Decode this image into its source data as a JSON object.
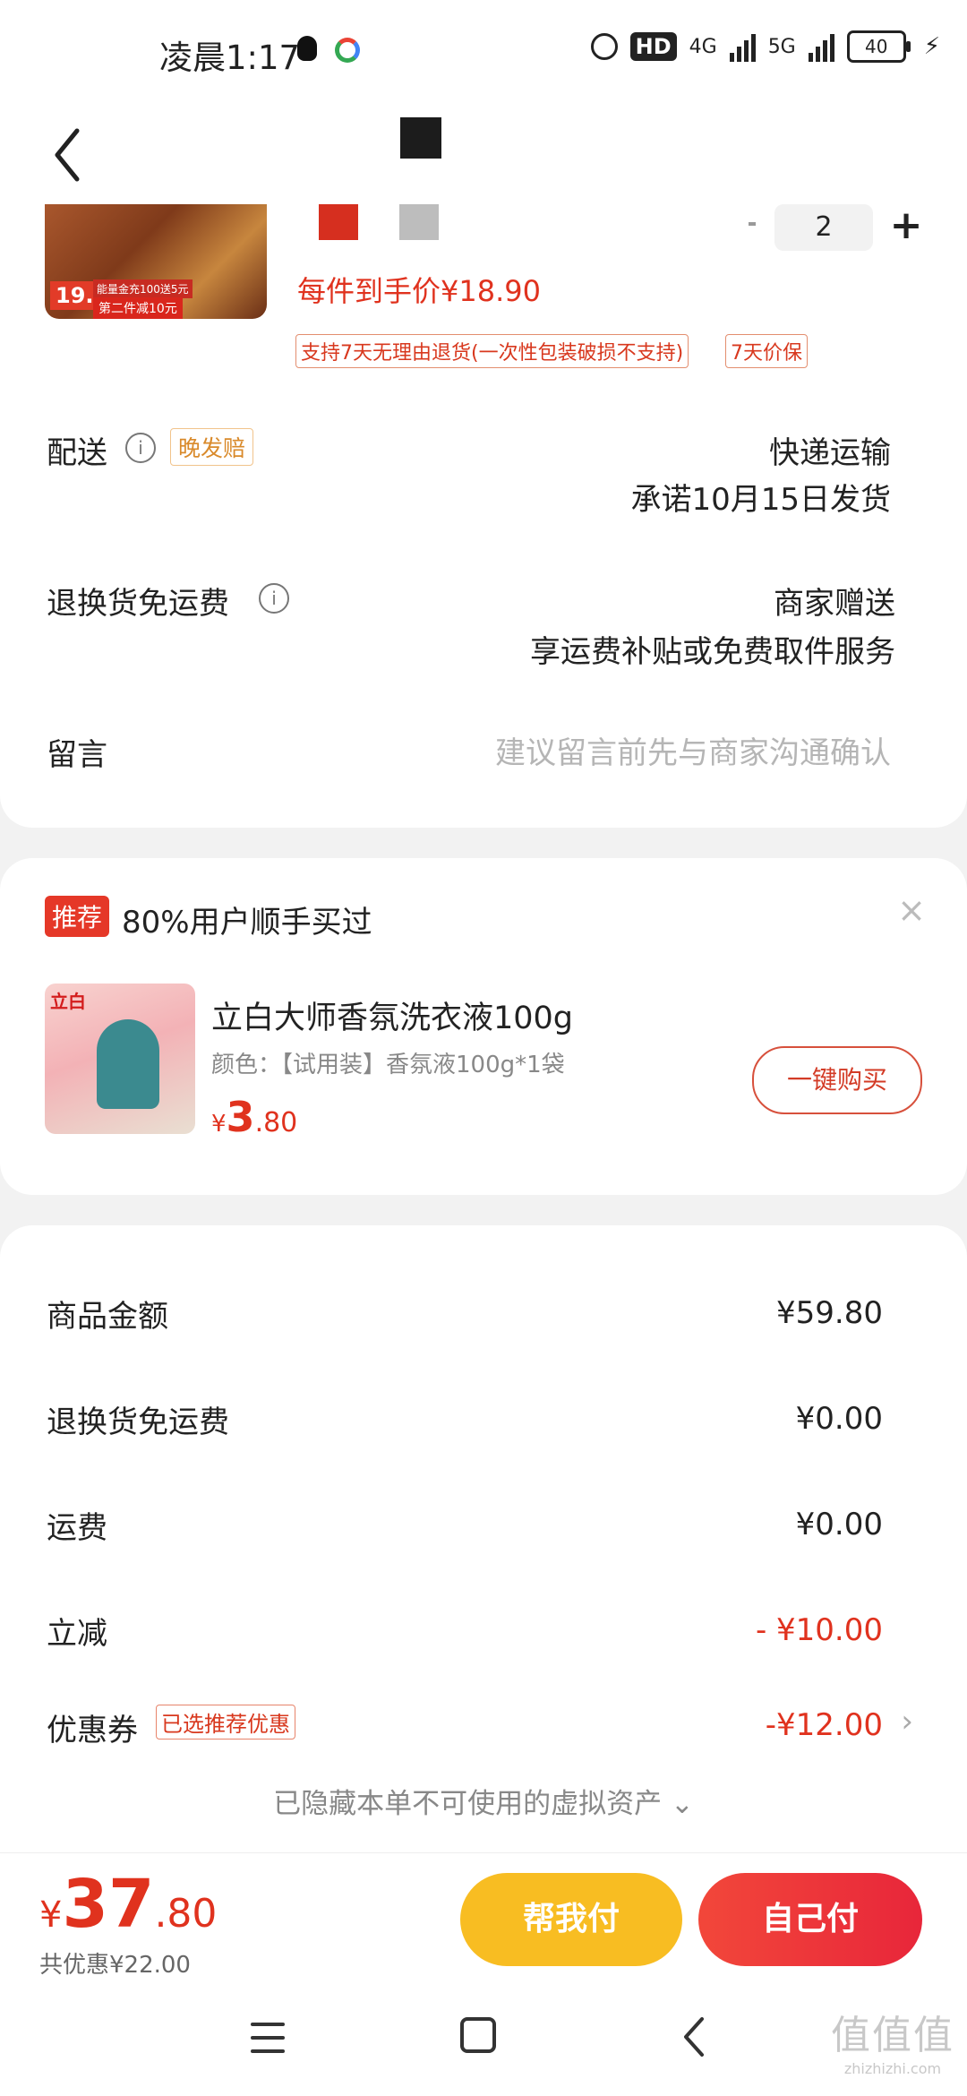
{
  "status_bar": {
    "time": "凌晨1:17",
    "network_hd": "HD",
    "network_4g": "4G",
    "network_5g": "5G",
    "battery": "40"
  },
  "product": {
    "image_price": "19.9",
    "image_promo1": "能量金充100送5元",
    "image_promo2": "第二件减10元",
    "swatch_colors": [
      "#d62f1f",
      "#bdbdbd"
    ],
    "quantity": "2",
    "plus": "+",
    "per_item_price": "每件到手价¥18.90",
    "tags": [
      "支持7天无理由退货(一次性包装破损不支持)",
      "7天价保"
    ]
  },
  "shipping": {
    "label": "配送",
    "info_icon": "i",
    "late_badge": "晚发赔",
    "method": "快递运输",
    "promise": "承诺10月15日发货"
  },
  "return_shipping": {
    "label": "退换货免运费",
    "info_icon": "i",
    "provider": "商家赠送",
    "desc": "享运费补贴或免费取件服务"
  },
  "message": {
    "label": "留言",
    "placeholder": "建议留言前先与商家沟通确认"
  },
  "recommend": {
    "badge": "推荐",
    "title": "80%用户顺手买过",
    "close": "×",
    "image_brand": "立白",
    "name": "立白大师香氛洗衣液100g",
    "spec": "颜色：【试用装】香氛液100g*1袋",
    "price_symbol": "¥",
    "price_int": "3",
    "price_dec": ".80",
    "buy_label": "一键购买"
  },
  "amounts": {
    "goods_label": "商品金额",
    "goods_value": "¥59.80",
    "return_label": "退换货免运费",
    "return_value": "¥0.00",
    "shipping_label": "运费",
    "shipping_value": "¥0.00",
    "discount_label": "立减",
    "discount_value": "- ¥10.00",
    "coupon_label": "优惠券",
    "coupon_tag": "已选推荐优惠",
    "coupon_value": "-¥12.00",
    "chevron": "›",
    "hidden_note": "已隐藏本单不可使用的虚拟资产 ⌄"
  },
  "bottom": {
    "total_symbol": "¥",
    "total_int": "37",
    "total_dec": ".80",
    "saving": "共优惠¥22.00",
    "help_pay": "帮我付",
    "self_pay": "自己付"
  },
  "watermark": {
    "big": "值值值",
    "small": "zhizhizhi.com"
  }
}
